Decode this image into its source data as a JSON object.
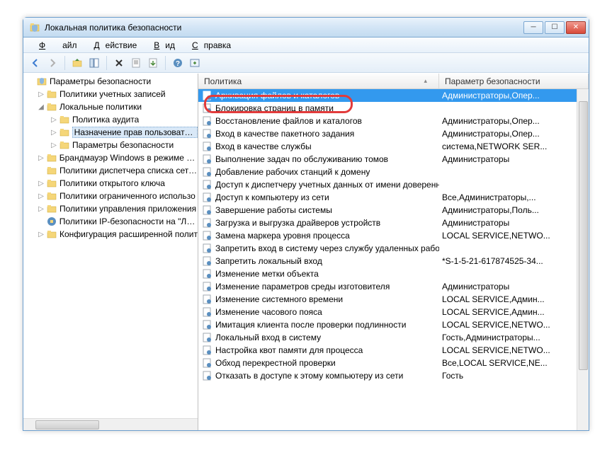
{
  "window": {
    "title": "Локальная политика безопасности"
  },
  "menu": {
    "file": "Файл",
    "action": "Действие",
    "view": "Вид",
    "help": "Справка"
  },
  "tree": {
    "root": "Параметры безопасности",
    "items": [
      {
        "label": "Политики учетных записей",
        "indent": 1,
        "expander": "▷"
      },
      {
        "label": "Локальные политики",
        "indent": 1,
        "expander": "◢"
      },
      {
        "label": "Политика аудита",
        "indent": 2,
        "expander": "▷"
      },
      {
        "label": "Назначение прав пользователя",
        "indent": 2,
        "expander": "▷",
        "selected": true
      },
      {
        "label": "Параметры безопасности",
        "indent": 2,
        "expander": "▷"
      },
      {
        "label": "Брандмауэр Windows в режиме пов",
        "indent": 1,
        "expander": "▷"
      },
      {
        "label": "Политики диспетчера списка сетей",
        "indent": 1,
        "expander": ""
      },
      {
        "label": "Политики открытого ключа",
        "indent": 1,
        "expander": "▷"
      },
      {
        "label": "Политики ограниченного использо",
        "indent": 1,
        "expander": "▷"
      },
      {
        "label": "Политики управления приложения",
        "indent": 1,
        "expander": "▷"
      },
      {
        "label": "Политики IP-безопасности на \"Лока",
        "indent": 1,
        "expander": "",
        "special": true
      },
      {
        "label": "Конфигурация расширенной полит",
        "indent": 1,
        "expander": "▷"
      }
    ]
  },
  "columns": {
    "c1": "Политика",
    "c2": "Параметр безопасности"
  },
  "rows": [
    {
      "name": "Архивация файлов и каталогов",
      "value": "Администраторы,Опер...",
      "selected": true
    },
    {
      "name": "Блокировка страниц в памяти",
      "value": ""
    },
    {
      "name": "Восстановление файлов и каталогов",
      "value": "Администраторы,Опер..."
    },
    {
      "name": "Вход в качестве пакетного задания",
      "value": "Администраторы,Опер..."
    },
    {
      "name": "Вход в качестве службы",
      "value": "система,NETWORK SER..."
    },
    {
      "name": "Выполнение задач по обслуживанию томов",
      "value": "Администраторы"
    },
    {
      "name": "Добавление рабочих станций к домену",
      "value": ""
    },
    {
      "name": "Доступ к диспетчеру учетных данных от имени доверенн...",
      "value": ""
    },
    {
      "name": "Доступ к компьютеру из сети",
      "value": "Все,Администраторы,..."
    },
    {
      "name": "Завершение работы системы",
      "value": "Администраторы,Поль..."
    },
    {
      "name": "Загрузка и выгрузка драйверов устройств",
      "value": "Администраторы"
    },
    {
      "name": "Замена маркера уровня процесса",
      "value": "LOCAL SERVICE,NETWO..."
    },
    {
      "name": "Запретить вход в систему через службу удаленных рабоч...",
      "value": ""
    },
    {
      "name": "Запретить локальный вход",
      "value": "*S-1-5-21-617874525-34..."
    },
    {
      "name": "Изменение метки объекта",
      "value": ""
    },
    {
      "name": "Изменение параметров среды изготовителя",
      "value": "Администраторы"
    },
    {
      "name": "Изменение системного времени",
      "value": "LOCAL SERVICE,Админ..."
    },
    {
      "name": "Изменение часового пояса",
      "value": "LOCAL SERVICE,Админ..."
    },
    {
      "name": "Имитация клиента после проверки подлинности",
      "value": "LOCAL SERVICE,NETWO..."
    },
    {
      "name": "Локальный вход в систему",
      "value": "Гость,Администраторы..."
    },
    {
      "name": "Настройка квот памяти для процесса",
      "value": "LOCAL SERVICE,NETWO..."
    },
    {
      "name": "Обход перекрестной проверки",
      "value": "Все,LOCAL SERVICE,NE..."
    },
    {
      "name": "Отказать в доступе к этому компьютеру из сети",
      "value": "Гость"
    }
  ]
}
